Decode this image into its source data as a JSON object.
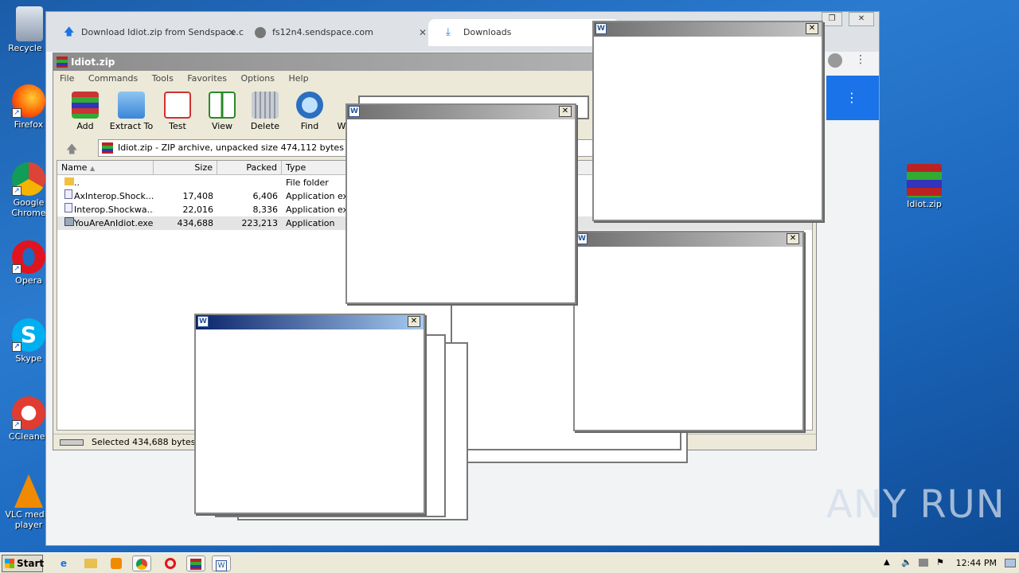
{
  "desktop": {
    "icons": [
      {
        "label": "Recycle B"
      },
      {
        "label": "Firefox"
      },
      {
        "label": "Google Chrome"
      },
      {
        "label": "Opera"
      },
      {
        "label": "Skype"
      },
      {
        "label": "CCleaner"
      },
      {
        "label": "VLC media player"
      },
      {
        "label": "Idiot.zip"
      }
    ]
  },
  "chrome": {
    "tabs": [
      {
        "label": "Download Idiot.zip from Sendspace.c",
        "icon": "upload-arrow-icon"
      },
      {
        "label": "fs12n4.sendspace.com",
        "icon": "globe-icon"
      },
      {
        "label": "Downloads",
        "icon": "download-icon"
      }
    ],
    "close_glyph": "✕"
  },
  "winrar": {
    "title": "Idiot.zip",
    "menu": [
      "File",
      "Commands",
      "Tools",
      "Favorites",
      "Options",
      "Help"
    ],
    "toolbar": [
      "Add",
      "Extract To",
      "Test",
      "View",
      "Delete",
      "Find",
      "W"
    ],
    "address": "Idiot.zip - ZIP archive, unpacked size 474,112 bytes",
    "columns": [
      "Name",
      "Size",
      "Packed",
      "Type"
    ],
    "rows": [
      {
        "name": "..",
        "size": "",
        "packed": "",
        "type": "File folder"
      },
      {
        "name": "AxInterop.Shock...",
        "size": "17,408",
        "packed": "6,406",
        "type": "Application exte"
      },
      {
        "name": "Interop.Shockwa...",
        "size": "22,016",
        "packed": "8,336",
        "type": "Application exte"
      },
      {
        "name": "YouAreAnIdiot.exe",
        "size": "434,688",
        "packed": "223,213",
        "type": "Application"
      }
    ],
    "status": "Selected 434,688 bytes in"
  },
  "popup": {
    "close_glyph": "✕",
    "icon_letter": "W"
  },
  "taskbar": {
    "start_label": "Start",
    "clock": "12:44 PM"
  },
  "watermark": "ANY RUN",
  "colors": {
    "accent": "#1a73e8",
    "popup_title_active": "#0a246a"
  }
}
